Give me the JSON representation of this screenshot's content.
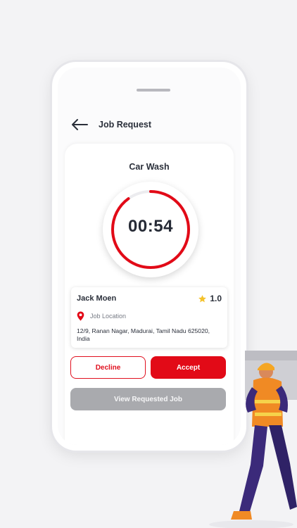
{
  "header": {
    "title": "Job Request",
    "back_icon": "arrow-left-icon"
  },
  "job": {
    "service": "Car Wash",
    "timer": "00:54",
    "timer_progress": 0.9,
    "accent_color": "#e20a17"
  },
  "customer": {
    "name": "Jack Moen",
    "rating": "1.0",
    "location_label": "Job Location",
    "address": "12/9, Ranan Nagar, Madurai, Tamil Nadu 625020, India"
  },
  "actions": {
    "decline": "Decline",
    "accept": "Accept",
    "view": "View Requested Job"
  },
  "illustration": "worker-carrying-box"
}
